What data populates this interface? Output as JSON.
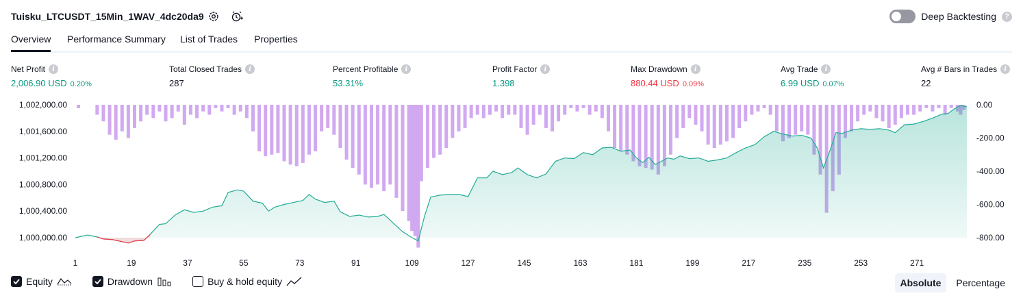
{
  "header": {
    "title": "Tuisku_LTCUSDT_15Min_1WAV_4dc20da9",
    "settings_icon": "gear-icon",
    "alert_icon": "add-alert-icon",
    "deep_backtesting_label": "Deep Backtesting",
    "deep_backtesting_on": false
  },
  "tabs": [
    {
      "label": "Overview",
      "active": true
    },
    {
      "label": "Performance Summary",
      "active": false
    },
    {
      "label": "List of Trades",
      "active": false
    },
    {
      "label": "Properties",
      "active": false
    }
  ],
  "metrics": [
    {
      "label": "Net Profit",
      "value": "2,006.90 USD",
      "pct": "0.20%",
      "color": "#089981"
    },
    {
      "label": "Total Closed Trades",
      "value": "287",
      "pct": "",
      "color": "#131722"
    },
    {
      "label": "Percent Profitable",
      "value": "53.31%",
      "pct": "",
      "color": "#089981"
    },
    {
      "label": "Profit Factor",
      "value": "1.398",
      "pct": "",
      "color": "#089981"
    },
    {
      "label": "Max Drawdown",
      "value": "880.44 USD",
      "pct": "0.09%",
      "color": "#f23645"
    },
    {
      "label": "Avg Trade",
      "value": "6.99 USD",
      "pct": "0.07%",
      "color": "#089981"
    },
    {
      "label": "Avg # Bars in Trades",
      "value": "22",
      "pct": "",
      "color": "#131722"
    }
  ],
  "legend": [
    {
      "label": "Equity",
      "checked": true,
      "icon": "equity-line-icon"
    },
    {
      "label": "Drawdown",
      "checked": true,
      "icon": "drawdown-bars-icon"
    },
    {
      "label": "Buy & hold equity",
      "checked": false,
      "icon": "buy-hold-line-icon"
    }
  ],
  "mode": {
    "absolute": "Absolute",
    "percentage": "Percentage",
    "selected": "Absolute"
  },
  "colors": {
    "equity_line": "#22ab94",
    "equity_negative": "#f23645",
    "drawdown_bar": "#d1a9f0",
    "drawdown_overlap": "#9598d8"
  },
  "chart_data": {
    "type": "area",
    "x_ticks": [
      "1",
      "19",
      "37",
      "55",
      "73",
      "91",
      "109",
      "127",
      "145",
      "163",
      "181",
      "199",
      "217",
      "235",
      "253",
      "271"
    ],
    "y_left_ticks": [
      "1,000,000.00",
      "1,000,400.00",
      "1,000,800.00",
      "1,001,200.00",
      "1,001,600.00",
      "1,002,000.00"
    ],
    "y_right_ticks": [
      "0.00",
      "-200.00",
      "-400.00",
      "-600.00",
      "-800.00"
    ],
    "ylim_left": [
      1000000,
      1002000
    ],
    "ylim_right": [
      -800,
      0
    ],
    "xlim": [
      1,
      287
    ],
    "series": [
      {
        "name": "Equity",
        "kind": "area",
        "points": [
          [
            1,
            1000000
          ],
          [
            5,
            1000040
          ],
          [
            8,
            1000010
          ],
          [
            10,
            999980
          ],
          [
            13,
            999970
          ],
          [
            15,
            999950
          ],
          [
            18,
            999920
          ],
          [
            20,
            999950
          ],
          [
            23,
            999960
          ],
          [
            25,
            1000050
          ],
          [
            28,
            1000200
          ],
          [
            30,
            1000210
          ],
          [
            33,
            1000340
          ],
          [
            36,
            1000420
          ],
          [
            39,
            1000380
          ],
          [
            42,
            1000400
          ],
          [
            45,
            1000460
          ],
          [
            48,
            1000480
          ],
          [
            50,
            1000680
          ],
          [
            53,
            1000720
          ],
          [
            55,
            1000700
          ],
          [
            58,
            1000550
          ],
          [
            61,
            1000520
          ],
          [
            63,
            1000400
          ],
          [
            65,
            1000460
          ],
          [
            68,
            1000500
          ],
          [
            71,
            1000530
          ],
          [
            74,
            1000560
          ],
          [
            76,
            1000650
          ],
          [
            78,
            1000580
          ],
          [
            81,
            1000530
          ],
          [
            84,
            1000550
          ],
          [
            86,
            1000390
          ],
          [
            89,
            1000320
          ],
          [
            92,
            1000340
          ],
          [
            95,
            1000310
          ],
          [
            98,
            1000320
          ],
          [
            100,
            1000350
          ],
          [
            103,
            1000220
          ],
          [
            106,
            1000090
          ],
          [
            109,
            1000000
          ],
          [
            111,
            999950
          ],
          [
            113,
            1000320
          ],
          [
            115,
            1000610
          ],
          [
            118,
            1000640
          ],
          [
            121,
            1000650
          ],
          [
            124,
            1000650
          ],
          [
            127,
            1000620
          ],
          [
            130,
            1000900
          ],
          [
            133,
            1000900
          ],
          [
            135,
            1001000
          ],
          [
            138,
            1000950
          ],
          [
            141,
            1000980
          ],
          [
            143,
            1001050
          ],
          [
            146,
            1000950
          ],
          [
            149,
            1000900
          ],
          [
            152,
            1000960
          ],
          [
            155,
            1001150
          ],
          [
            158,
            1001200
          ],
          [
            161,
            1001190
          ],
          [
            164,
            1001280
          ],
          [
            167,
            1001250
          ],
          [
            170,
            1001350
          ],
          [
            173,
            1001360
          ],
          [
            176,
            1001300
          ],
          [
            179,
            1001320
          ],
          [
            181,
            1001200
          ],
          [
            183,
            1001130
          ],
          [
            185,
            1001210
          ],
          [
            187,
            1001100
          ],
          [
            189,
            1001150
          ],
          [
            191,
            1001200
          ],
          [
            193,
            1001180
          ],
          [
            195,
            1001230
          ],
          [
            198,
            1001190
          ],
          [
            201,
            1001200
          ],
          [
            204,
            1001150
          ],
          [
            207,
            1001170
          ],
          [
            210,
            1001200
          ],
          [
            213,
            1001280
          ],
          [
            216,
            1001350
          ],
          [
            219,
            1001400
          ],
          [
            222,
            1001520
          ],
          [
            225,
            1001600
          ],
          [
            228,
            1001560
          ],
          [
            231,
            1001530
          ],
          [
            234,
            1001540
          ],
          [
            237,
            1001500
          ],
          [
            239,
            1001350
          ],
          [
            241,
            1001050
          ],
          [
            243,
            1001300
          ],
          [
            245,
            1001580
          ],
          [
            247,
            1001570
          ],
          [
            250,
            1001620
          ],
          [
            253,
            1001640
          ],
          [
            256,
            1001630
          ],
          [
            259,
            1001640
          ],
          [
            262,
            1001620
          ],
          [
            264,
            1001580
          ],
          [
            267,
            1001700
          ],
          [
            270,
            1001710
          ],
          [
            273,
            1001750
          ],
          [
            276,
            1001800
          ],
          [
            279,
            1001860
          ],
          [
            281,
            1001870
          ],
          [
            283,
            1001940
          ],
          [
            285,
            1001990
          ],
          [
            287,
            1001970
          ]
        ]
      },
      {
        "name": "Drawdown",
        "kind": "bar",
        "points": [
          [
            2,
            -20
          ],
          [
            8,
            -60
          ],
          [
            10,
            -100
          ],
          [
            12,
            -180
          ],
          [
            14,
            -210
          ],
          [
            16,
            -160
          ],
          [
            18,
            -200
          ],
          [
            20,
            -140
          ],
          [
            22,
            -100
          ],
          [
            24,
            -60
          ],
          [
            26,
            -80
          ],
          [
            28,
            -40
          ],
          [
            30,
            -100
          ],
          [
            32,
            -80
          ],
          [
            34,
            -40
          ],
          [
            36,
            -120
          ],
          [
            38,
            -60
          ],
          [
            40,
            -80
          ],
          [
            42,
            -40
          ],
          [
            44,
            -60
          ],
          [
            46,
            -20
          ],
          [
            48,
            -40
          ],
          [
            50,
            -20
          ],
          [
            52,
            -60
          ],
          [
            54,
            -40
          ],
          [
            56,
            -80
          ],
          [
            58,
            -160
          ],
          [
            60,
            -280
          ],
          [
            62,
            -310
          ],
          [
            64,
            -300
          ],
          [
            66,
            -290
          ],
          [
            68,
            -340
          ],
          [
            70,
            -360
          ],
          [
            72,
            -370
          ],
          [
            74,
            -350
          ],
          [
            76,
            -300
          ],
          [
            78,
            -280
          ],
          [
            80,
            -160
          ],
          [
            82,
            -140
          ],
          [
            84,
            -180
          ],
          [
            86,
            -260
          ],
          [
            88,
            -330
          ],
          [
            90,
            -380
          ],
          [
            92,
            -420
          ],
          [
            94,
            -480
          ],
          [
            96,
            -500
          ],
          [
            98,
            -480
          ],
          [
            100,
            -520
          ],
          [
            102,
            -480
          ],
          [
            104,
            -560
          ],
          [
            106,
            -640
          ],
          [
            108,
            -700
          ],
          [
            109,
            -760
          ],
          [
            110,
            -790
          ],
          [
            111,
            -860
          ],
          [
            112,
            -460
          ],
          [
            114,
            -380
          ],
          [
            116,
            -320
          ],
          [
            118,
            -300
          ],
          [
            120,
            -260
          ],
          [
            122,
            -200
          ],
          [
            124,
            -160
          ],
          [
            126,
            -140
          ],
          [
            128,
            -80
          ],
          [
            130,
            -60
          ],
          [
            132,
            -80
          ],
          [
            134,
            -60
          ],
          [
            136,
            -40
          ],
          [
            138,
            -80
          ],
          [
            140,
            -60
          ],
          [
            142,
            -60
          ],
          [
            144,
            -140
          ],
          [
            146,
            -180
          ],
          [
            148,
            -120
          ],
          [
            150,
            -60
          ],
          [
            152,
            -140
          ],
          [
            154,
            -160
          ],
          [
            156,
            -100
          ],
          [
            158,
            -60
          ],
          [
            160,
            -20
          ],
          [
            162,
            -40
          ],
          [
            164,
            -20
          ],
          [
            166,
            -60
          ],
          [
            168,
            -40
          ],
          [
            170,
            -80
          ],
          [
            172,
            -160
          ],
          [
            174,
            -260
          ],
          [
            176,
            -280
          ],
          [
            178,
            -300
          ],
          [
            180,
            -340
          ],
          [
            182,
            -370
          ],
          [
            184,
            -380
          ],
          [
            186,
            -390
          ],
          [
            188,
            -420
          ],
          [
            190,
            -370
          ],
          [
            192,
            -300
          ],
          [
            194,
            -200
          ],
          [
            196,
            -140
          ],
          [
            198,
            -80
          ],
          [
            200,
            -120
          ],
          [
            202,
            -160
          ],
          [
            204,
            -240
          ],
          [
            206,
            -260
          ],
          [
            208,
            -240
          ],
          [
            210,
            -220
          ],
          [
            212,
            -200
          ],
          [
            214,
            -140
          ],
          [
            216,
            -100
          ],
          [
            218,
            -60
          ],
          [
            220,
            -40
          ],
          [
            222,
            -20
          ],
          [
            224,
            -60
          ],
          [
            226,
            -160
          ],
          [
            228,
            -220
          ],
          [
            230,
            -200
          ],
          [
            232,
            -180
          ],
          [
            234,
            -160
          ],
          [
            236,
            -180
          ],
          [
            238,
            -300
          ],
          [
            240,
            -420
          ],
          [
            242,
            -650
          ],
          [
            244,
            -520
          ],
          [
            246,
            -420
          ],
          [
            248,
            -200
          ],
          [
            250,
            -160
          ],
          [
            252,
            -100
          ],
          [
            254,
            -60
          ],
          [
            256,
            -40
          ],
          [
            258,
            -80
          ],
          [
            260,
            -100
          ],
          [
            262,
            -140
          ],
          [
            264,
            -120
          ],
          [
            266,
            -80
          ],
          [
            268,
            -60
          ],
          [
            270,
            -60
          ],
          [
            272,
            -40
          ],
          [
            274,
            -20
          ],
          [
            276,
            -40
          ],
          [
            278,
            -20
          ],
          [
            280,
            -60
          ],
          [
            282,
            -20
          ],
          [
            284,
            -40
          ],
          [
            285,
            -60
          ],
          [
            286,
            -30
          ]
        ]
      }
    ]
  }
}
